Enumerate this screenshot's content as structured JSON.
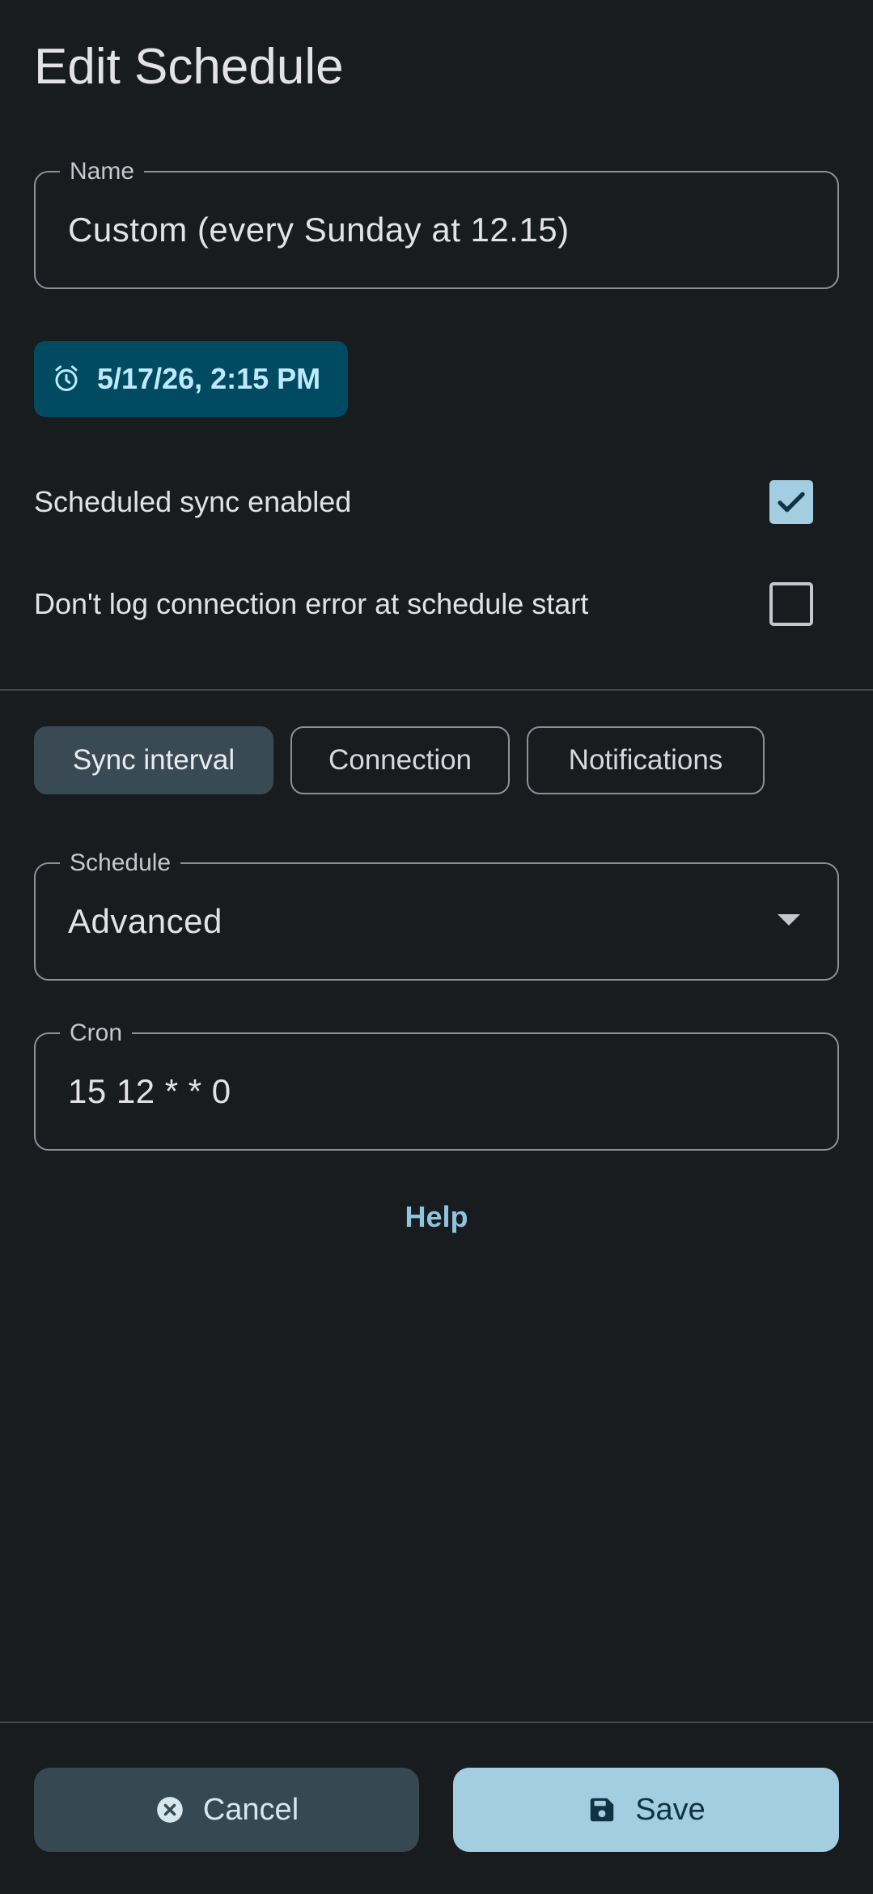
{
  "dialog": {
    "title": "Edit Schedule"
  },
  "name_field": {
    "label": "Name",
    "value": "Custom (every Sunday at 12.15)"
  },
  "next_run_chip": {
    "icon": "alarm-icon",
    "label": "5/17/26, 2:15 PM"
  },
  "options": {
    "scheduled_sync": {
      "label": "Scheduled sync enabled",
      "checked": true
    },
    "dont_log_error": {
      "label": "Don't log connection error at schedule start",
      "checked": false
    }
  },
  "tabs": [
    {
      "label": "Sync interval",
      "active": true
    },
    {
      "label": "Connection",
      "active": false
    },
    {
      "label": "Notifications",
      "active": false
    }
  ],
  "schedule_field": {
    "label": "Schedule",
    "selected": "Advanced"
  },
  "cron_field": {
    "label": "Cron",
    "value": "15 12 * * 0"
  },
  "help": {
    "label": "Help"
  },
  "actions": {
    "cancel_label": "Cancel",
    "save_label": "Save"
  },
  "colors": {
    "background": "#191c1f",
    "chip_bg": "#004b62",
    "primary": "#a3cde0",
    "active_tab": "#3a4a54"
  }
}
